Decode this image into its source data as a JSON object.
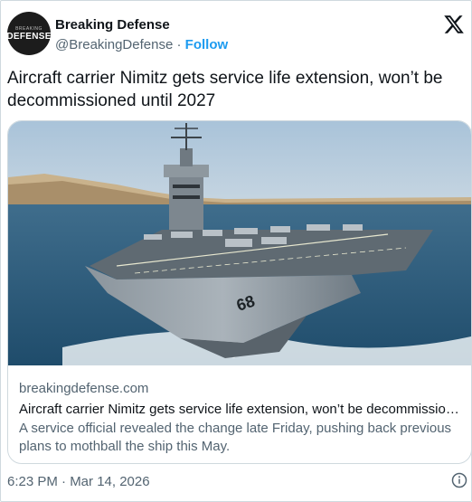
{
  "author": {
    "name": "Breaking Defense",
    "handle": "@BreakingDefense",
    "separator": "·",
    "follow_label": "Follow",
    "avatar_text_small": "BREAKING",
    "avatar_text_big": "DEFENSE"
  },
  "tweet": {
    "text": "Aircraft carrier Nimitz gets service life extension, won’t be decommissioned until 2027"
  },
  "card": {
    "domain": "breakingdefense.com",
    "title": "Aircraft carrier Nimitz gets service life extension, won’t be decommission...",
    "description": "A service official revealed the change late Friday, pushing back previous plans to mothball the ship this May.",
    "image_alt": "Aircraft carrier at sea"
  },
  "footer": {
    "timestamp": "6:23 PM · Mar 14, 2026"
  },
  "icons": {
    "platform": "x-logo-icon",
    "info": "info-icon"
  },
  "colors": {
    "link": "#1d9bf0",
    "secondary_text": "#536471",
    "border": "#cfd9de"
  }
}
